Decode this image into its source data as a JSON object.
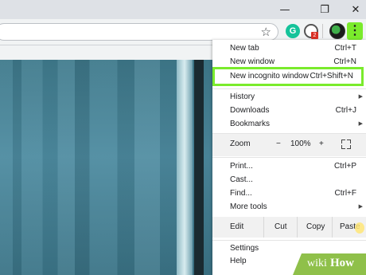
{
  "window": {
    "minimize_glyph": "—",
    "restore_glyph": "❐",
    "close_glyph": "✕"
  },
  "toolbar": {
    "bookmark_icon": "star-outline",
    "extensions": [
      {
        "name": "grammarly",
        "glyph": "G"
      },
      {
        "name": "pin-extension",
        "badge": "2"
      }
    ],
    "menu_glyph": "⋮"
  },
  "menu": {
    "items": [
      {
        "label": "New tab",
        "shortcut": "Ctrl+T"
      },
      {
        "label": "New window",
        "shortcut": "Ctrl+N"
      },
      {
        "label": "New incognito window",
        "shortcut": "Ctrl+Shift+N"
      },
      {
        "label": "History",
        "shortcut": ""
      },
      {
        "label": "Downloads",
        "shortcut": "Ctrl+J"
      },
      {
        "label": "Bookmarks",
        "shortcut": ""
      },
      {
        "label": "Print...",
        "shortcut": "Ctrl+P"
      },
      {
        "label": "Cast...",
        "shortcut": ""
      },
      {
        "label": "Find...",
        "shortcut": "Ctrl+F"
      },
      {
        "label": "More tools",
        "shortcut": ""
      },
      {
        "label": "Settings",
        "shortcut": ""
      },
      {
        "label": "Help",
        "shortcut": ""
      }
    ],
    "zoom": {
      "label": "Zoom",
      "minus": "−",
      "value": "100%",
      "plus": "+"
    },
    "edit": {
      "label": "Edit",
      "cut": "Cut",
      "copy": "Copy",
      "paste": "Paste"
    }
  },
  "watermark": {
    "part1": "wiki",
    "part2": "How"
  },
  "colors": {
    "highlight": "#7aeb2c",
    "page_bg": "#4d8ba0"
  }
}
